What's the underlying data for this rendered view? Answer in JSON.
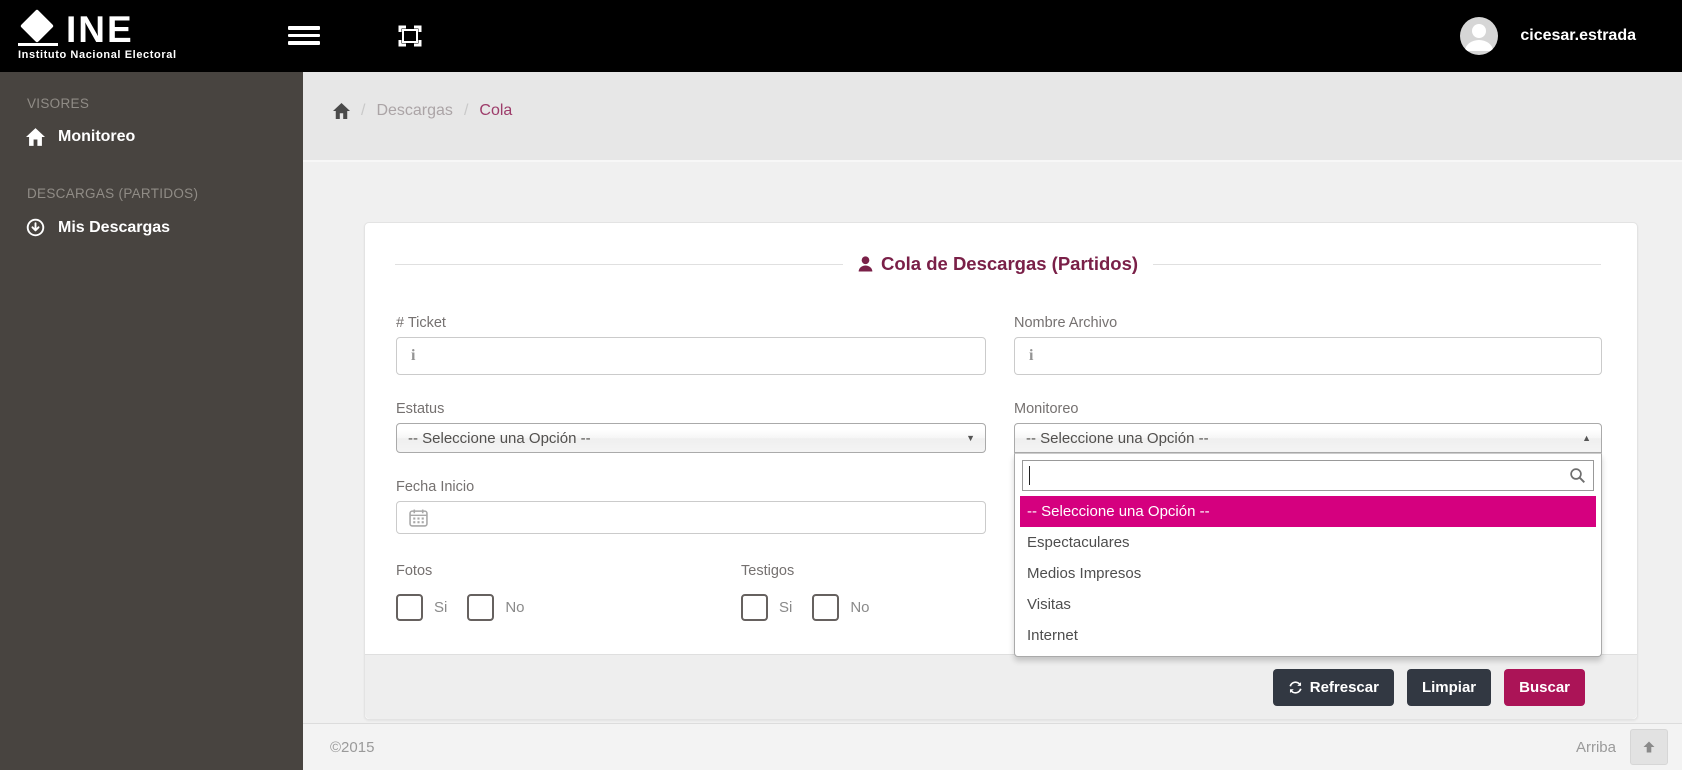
{
  "navbar": {
    "brand": {
      "name": "INE",
      "caption": "Instituto Nacional Electoral"
    },
    "username": "cicesar.estrada"
  },
  "sidebar": {
    "sections": [
      {
        "header": "VISORES",
        "items": [
          {
            "label": "Monitoreo",
            "icon": "home-icon"
          }
        ]
      },
      {
        "header": "DESCARGAS (PARTIDOS)",
        "items": [
          {
            "label": "Mis Descargas",
            "icon": "download-circle-icon"
          }
        ]
      }
    ]
  },
  "breadcrumb": {
    "separator": "/",
    "items": [
      "Descargas",
      "Cola"
    ]
  },
  "panel": {
    "title": "Cola de Descargas (Partidos)",
    "fields": {
      "ticket": {
        "label": "# Ticket",
        "value": ""
      },
      "archivo": {
        "label": "Nombre Archivo",
        "value": ""
      },
      "estatus": {
        "label": "Estatus",
        "selected": "-- Seleccione una Opción --"
      },
      "monitoreo": {
        "label": "Monitoreo",
        "selected": "-- Seleccione una Opción --",
        "search_value": "",
        "options": [
          "-- Seleccione una Opción --",
          "Espectaculares",
          "Medios Impresos",
          "Visitas",
          "Internet"
        ],
        "highlighted_option": "-- Seleccione una Opción --"
      },
      "fecha_inicio": {
        "label": "Fecha Inicio",
        "value": ""
      },
      "fotos": {
        "label": "Fotos",
        "options": [
          "Si",
          "No"
        ]
      },
      "testigos": {
        "label": "Testigos",
        "options": [
          "Si",
          "No"
        ]
      }
    },
    "buttons": {
      "refrescar": "Refrescar",
      "limpiar": "Limpiar",
      "buscar": "Buscar"
    }
  },
  "footer": {
    "copyright": "©2015",
    "back_to_top": "Arriba"
  },
  "icons": {
    "chevron_down": "▼",
    "chevron_up": "▲",
    "info": "i"
  },
  "colors": {
    "accent_pink": "#d5007f",
    "title_maroon": "#7a2048",
    "buscar_button": "#ab1457",
    "dark_button": "#323842",
    "sidebar_bg": "#484440",
    "navbar_bg": "#000000"
  }
}
